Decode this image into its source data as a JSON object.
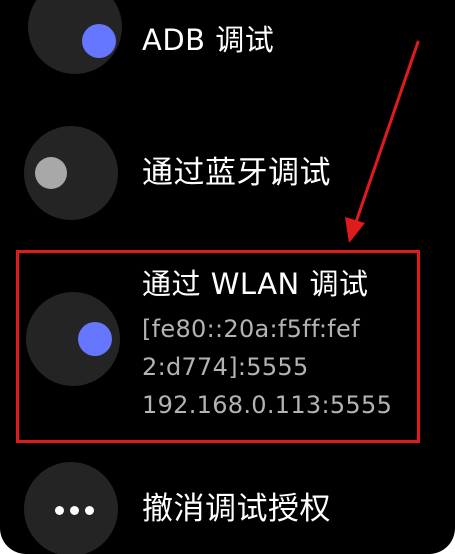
{
  "settings": {
    "adb_debugging": {
      "label": "ADB 调试",
      "enabled": true
    },
    "bluetooth_debugging": {
      "label": "通过蓝牙调试",
      "enabled": false
    },
    "wlan_debugging": {
      "label": "通过 WLAN 调试",
      "enabled": true,
      "address_line_1": "[fe80::20a:f5ff:fef",
      "address_line_2": "2:d774]:5555",
      "address_line_3": "192.168.0.113:5555"
    },
    "revoke_authorization": {
      "label": "撤消调试授权",
      "icon": "more-horizontal-icon"
    }
  },
  "annotations": {
    "highlight_color": "#e01b1b",
    "arrow_color": "#e01b1b"
  },
  "colors": {
    "toggle_on": "#6677ff",
    "toggle_off": "#a8a8a8",
    "toggle_background": "#242424",
    "screen_background": "#000000"
  }
}
